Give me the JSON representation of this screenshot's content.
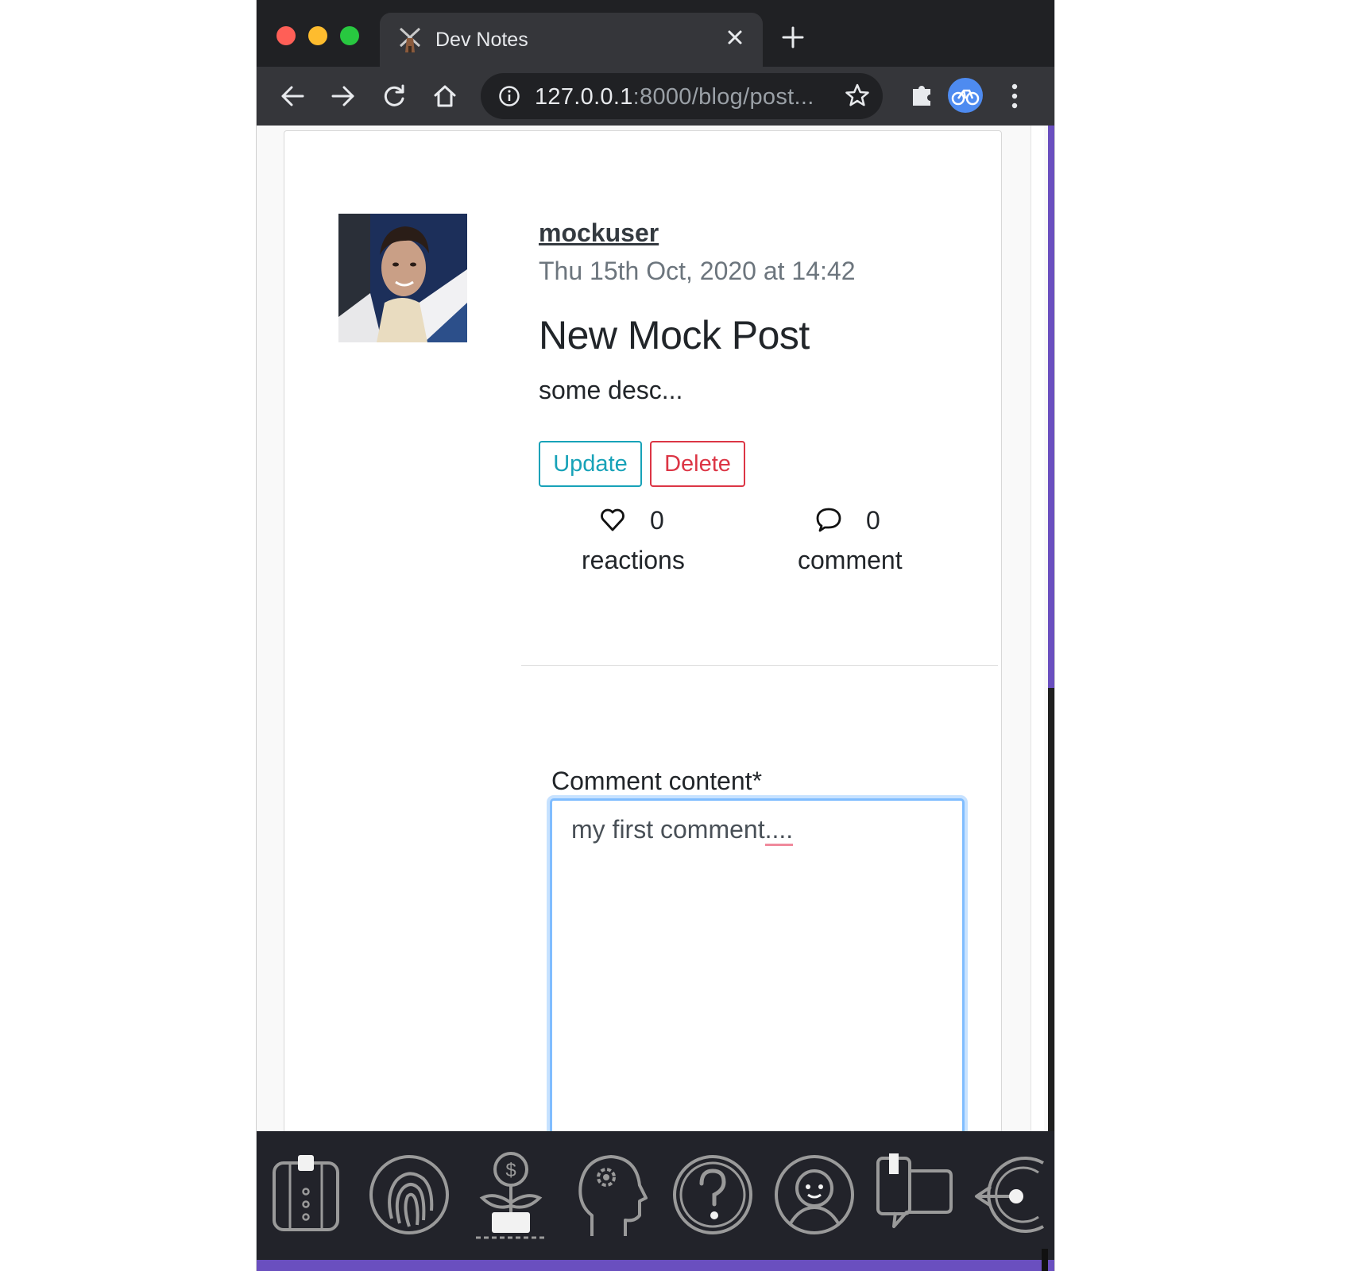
{
  "browser": {
    "tab_title": "Dev Notes",
    "url_host": "127.0.0.1",
    "url_rest": ":8000/blog/post..."
  },
  "post": {
    "author": "mockuser",
    "date": "Thu 15th Oct, 2020 at 14:42",
    "title": "New Mock Post",
    "description": "some desc...",
    "update_label": "Update",
    "delete_label": "Delete",
    "reactions_count": "0",
    "reactions_label": "reactions",
    "comments_count": "0",
    "comments_label": "comment"
  },
  "comment_form": {
    "label": "Comment content*",
    "value_main": "my first comment",
    "value_misspelled": "...."
  },
  "dock": {
    "icons": [
      "suit-icon",
      "fingerprint-icon",
      "money-plant-icon",
      "gear-head-icon",
      "question-icon",
      "face-avatar-icon",
      "book-chat-icon",
      "exit-icon"
    ]
  },
  "colors": {
    "accent_purple": "#6a4fbf",
    "update_teal": "#17a2b8",
    "delete_red": "#dc3545",
    "focus_blue": "#80bdff"
  }
}
